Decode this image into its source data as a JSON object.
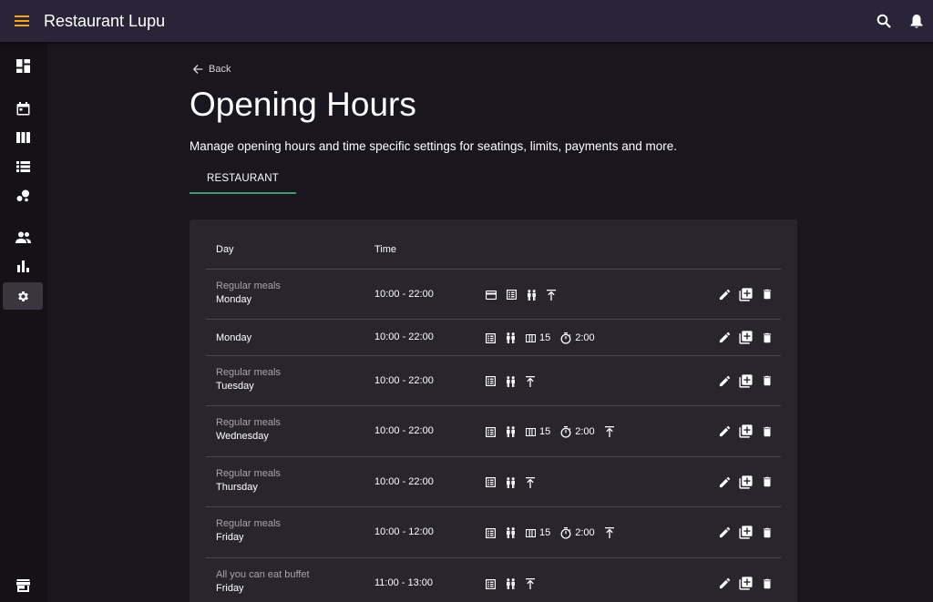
{
  "app": {
    "title": "Restaurant Lupu"
  },
  "page": {
    "back_label": "Back",
    "title": "Opening Hours",
    "description": "Manage opening hours and time specific settings for seatings, limits, payments and more.",
    "tab": "RESTAURANT"
  },
  "table": {
    "headers": {
      "day": "Day",
      "time": "Time"
    },
    "rows": [
      {
        "meal": "Regular meals",
        "day": "Monday",
        "time": "10:00 - 22:00",
        "features": [
          "payment",
          "menu",
          "guests",
          "limit"
        ],
        "seats": "",
        "duration": ""
      },
      {
        "meal": "",
        "day": "Monday",
        "time": "10:00 - 22:00",
        "features": [
          "menu",
          "guests",
          "seats",
          "duration"
        ],
        "seats": "15",
        "duration": "2:00"
      },
      {
        "meal": "Regular meals",
        "day": "Tuesday",
        "time": "10:00 - 22:00",
        "features": [
          "menu",
          "guests",
          "limit"
        ],
        "seats": "",
        "duration": ""
      },
      {
        "meal": "Regular meals",
        "day": "Wednesday",
        "time": "10:00 - 22:00",
        "features": [
          "menu",
          "guests",
          "seats",
          "duration",
          "limit"
        ],
        "seats": "15",
        "duration": "2:00"
      },
      {
        "meal": "Regular meals",
        "day": "Thursday",
        "time": "10:00 - 22:00",
        "features": [
          "menu",
          "guests",
          "limit"
        ],
        "seats": "",
        "duration": ""
      },
      {
        "meal": "Regular meals",
        "day": "Friday",
        "time": "10:00 - 12:00",
        "features": [
          "menu",
          "guests",
          "seats",
          "duration",
          "limit"
        ],
        "seats": "15",
        "duration": "2:00"
      },
      {
        "meal": "All you can eat buffet",
        "day": "Friday",
        "time": "11:00 - 13:00",
        "features": [
          "menu",
          "guests",
          "limit"
        ],
        "seats": "",
        "duration": ""
      }
    ]
  },
  "icons": {
    "menu": "hamburger-icon",
    "search": "search-icon",
    "notifications": "bell-icon",
    "sidebar": [
      "dashboard-icon",
      "calendar-icon",
      "columns-icon",
      "list-icon",
      "bubbles-icon",
      "people-icon",
      "bar-chart-icon",
      "gear-icon",
      "store-icon"
    ],
    "row_actions": [
      "edit-icon",
      "duplicate-icon",
      "delete-icon"
    ]
  },
  "colors": {
    "topbar": "#2a2438",
    "background": "#19161f",
    "sidebar": "#141117",
    "card": "#28252d",
    "accent_menu": "#f5a623",
    "tab_underline": "#3f9b6e"
  }
}
